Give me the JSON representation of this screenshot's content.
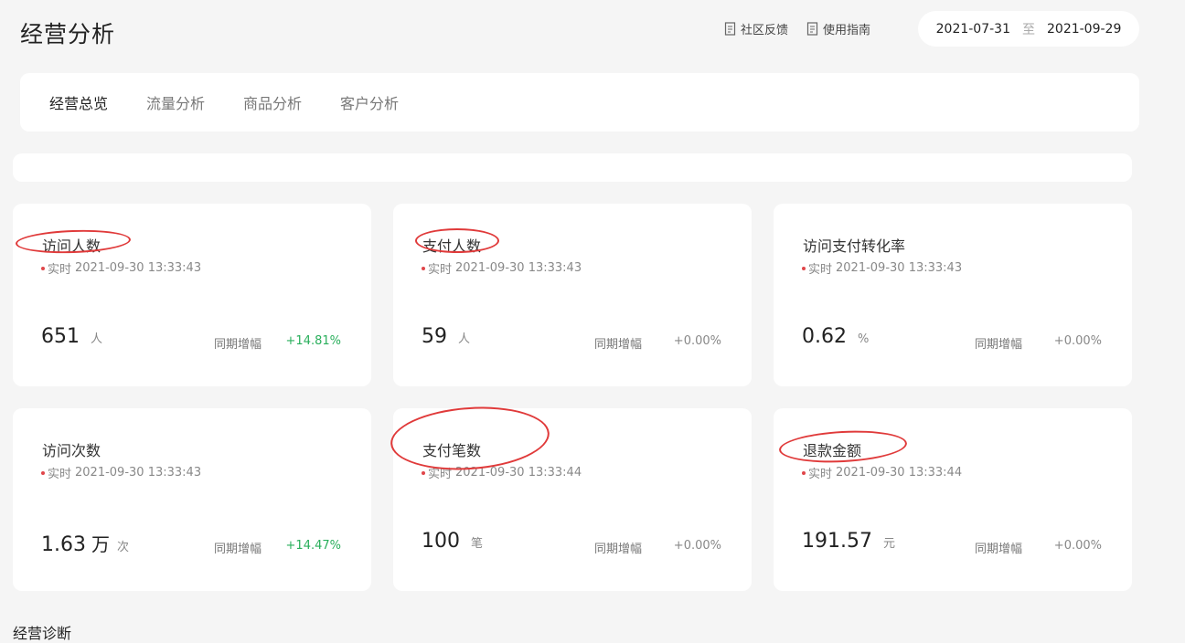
{
  "page": {
    "title": "经营分析"
  },
  "header": {
    "links": [
      {
        "label": "社区反馈",
        "icon": "document-icon"
      },
      {
        "label": "使用指南",
        "icon": "document-icon"
      }
    ],
    "date_range": {
      "start": "2021-07-31",
      "separator": "至",
      "end": "2021-09-29"
    }
  },
  "tabs": [
    {
      "label": "经营总览",
      "active": true
    },
    {
      "label": "流量分析",
      "active": false
    },
    {
      "label": "商品分析",
      "active": false
    },
    {
      "label": "客户分析",
      "active": false
    }
  ],
  "metrics": [
    {
      "title": "访问人数",
      "realtime_label": "实时",
      "time": "2021-09-30 13:33:43",
      "value": "651",
      "value_suffix": "",
      "unit": "人",
      "compare_label": "同期增幅",
      "compare_value": "+14.81%",
      "trend": "up"
    },
    {
      "title": "支付人数",
      "realtime_label": "实时",
      "time": "2021-09-30 13:33:43",
      "value": "59",
      "value_suffix": "",
      "unit": "人",
      "compare_label": "同期增幅",
      "compare_value": "+0.00%",
      "trend": "flat"
    },
    {
      "title": "访问支付转化率",
      "realtime_label": "实时",
      "time": "2021-09-30 13:33:43",
      "value": "0.62",
      "value_suffix": "",
      "unit": "%",
      "compare_label": "同期增幅",
      "compare_value": "+0.00%",
      "trend": "flat"
    },
    {
      "title": "访问次数",
      "realtime_label": "实时",
      "time": "2021-09-30 13:33:43",
      "value": "1.63",
      "value_suffix": "万",
      "unit": "次",
      "compare_label": "同期增幅",
      "compare_value": "+14.47%",
      "trend": "up"
    },
    {
      "title": "支付笔数",
      "realtime_label": "实时",
      "time": "2021-09-30 13:33:44",
      "value": "100",
      "value_suffix": "",
      "unit": "笔",
      "compare_label": "同期增幅",
      "compare_value": "+0.00%",
      "trend": "flat"
    },
    {
      "title": "退款金额",
      "realtime_label": "实时",
      "time": "2021-09-30 13:33:44",
      "value": "191.57",
      "value_suffix": "",
      "unit": "元",
      "compare_label": "同期增幅",
      "compare_value": "+0.00%",
      "trend": "flat"
    }
  ],
  "section": {
    "title": "经营诊断"
  },
  "colors": {
    "accent_red": "#e03a3a",
    "up_green": "#2aaf5c",
    "background": "#f5f5f5"
  }
}
